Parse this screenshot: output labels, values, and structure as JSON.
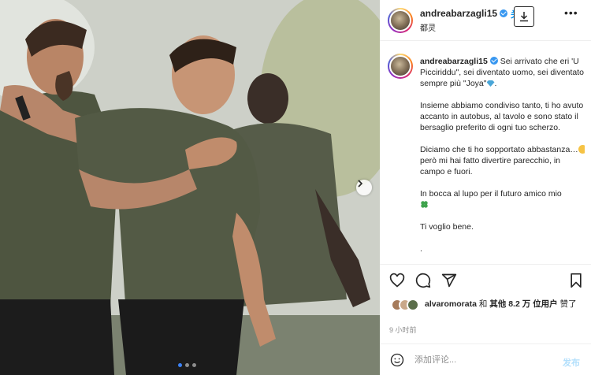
{
  "post": {
    "username": "andreabarzagli15",
    "follow_label": "关注",
    "location": "都灵",
    "caption_paragraphs": [
      "Sei arrivato che eri 'U Picciriddu\", sei diventato uomo, sei diventato sempre più \"Joya\"",
      "Insieme abbiamo condiviso tanto, ti ho avuto accanto in autobus, al tavolo e sono stato il bersaglio preferito di ogni tuo scherzo.",
      "Diciamo che ti ho sopportato abbastanza…",
      "però mi hai fatto divertire parecchio, in campo e fuori.",
      "In bocca al lupo per il futuro amico mio",
      "Ti voglio bene.",
      "."
    ],
    "likes": {
      "prefix_user": "alvaromorata",
      "middle": " 和 ",
      "others_label": "其他 8.2 万 位用户",
      "suffix": " 赞了"
    },
    "time_ago": "9 小时前",
    "comment_placeholder": "添加评论...",
    "post_button": "发布"
  },
  "carousel": {
    "current": 1,
    "total": 3
  },
  "icons": {
    "like": "heart-icon",
    "comment": "comment-icon",
    "share": "send-icon",
    "save": "bookmark-icon",
    "download": "download-icon",
    "more": "more-icon",
    "next": "chevron-right-icon",
    "emoji": "smiley-icon"
  },
  "colors": {
    "accent": "#0095f6",
    "verified": "#3897f0",
    "text": "#262626",
    "muted": "#8e8e8e",
    "carousel_active_dot": "#3b82f6"
  }
}
